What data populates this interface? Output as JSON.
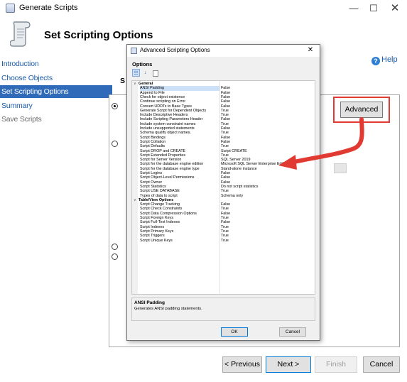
{
  "window": {
    "title": "Generate Scripts",
    "page_title": "Set Scripting Options",
    "controls": [
      "—",
      "☐",
      "✕"
    ]
  },
  "sidebar": {
    "items": [
      {
        "label": "Introduction"
      },
      {
        "label": "Choose Objects"
      },
      {
        "label": "Set Scripting Options",
        "active": true
      },
      {
        "label": "Summary"
      },
      {
        "label": "Save Scripts"
      }
    ]
  },
  "help": {
    "label": "Help"
  },
  "main": {
    "partial_label": "S",
    "advanced_label": "Advanced"
  },
  "footer": {
    "previous": "< Previous",
    "next": "Next >",
    "finish": "Finish",
    "cancel": "Cancel"
  },
  "dialog": {
    "title": "Advanced Scripting Options",
    "close": "✕",
    "options_heading": "Options",
    "categories": [
      {
        "name": "General",
        "rows": [
          {
            "name": "ANSI Padding",
            "value": "False"
          },
          {
            "name": "Append to File",
            "value": "False"
          },
          {
            "name": "Check for object existence",
            "value": "False"
          },
          {
            "name": "Continue scripting on Error",
            "value": "False"
          },
          {
            "name": "Convert UDDTs to Base Types",
            "value": "False"
          },
          {
            "name": "Generate Script for Dependent Objects",
            "value": "True"
          },
          {
            "name": "Include Descriptive Headers",
            "value": "True"
          },
          {
            "name": "Include Scripting Parameters Header",
            "value": "False"
          },
          {
            "name": "Include system constraint names",
            "value": "True"
          },
          {
            "name": "Include unsupported statements",
            "value": "False"
          },
          {
            "name": "Schema qualify object names.",
            "value": "True"
          },
          {
            "name": "Script Bindings",
            "value": "False"
          },
          {
            "name": "Script Collation",
            "value": "False"
          },
          {
            "name": "Script Defaults",
            "value": "True"
          },
          {
            "name": "Script DROP and CREATE",
            "value": "Script CREATE"
          },
          {
            "name": "Script Extended Properties",
            "value": "True"
          },
          {
            "name": "Script for Server Version",
            "value": "SQL Server 2019"
          },
          {
            "name": "Script for the database engine edition",
            "value": "Microsoft SQL Server Enterprise Edition"
          },
          {
            "name": "Script for the database engine type",
            "value": "Stand-alone instance"
          },
          {
            "name": "Script Logins",
            "value": "False"
          },
          {
            "name": "Script Object-Level Permissions",
            "value": "False"
          },
          {
            "name": "Script Owner",
            "value": "False"
          },
          {
            "name": "Script Statistics",
            "value": "Do not script statistics"
          },
          {
            "name": "Script USE DATABASE",
            "value": "True"
          },
          {
            "name": "Types of data to script",
            "value": "Schema only"
          }
        ]
      },
      {
        "name": "Table/View Options",
        "rows": [
          {
            "name": "Script Change Tracking",
            "value": "False"
          },
          {
            "name": "Script Check Constraints",
            "value": "True"
          },
          {
            "name": "Script Data Compression Options",
            "value": "False"
          },
          {
            "name": "Script Foreign Keys",
            "value": "True"
          },
          {
            "name": "Script Full-Text Indexes",
            "value": "False"
          },
          {
            "name": "Script Indexes",
            "value": "True"
          },
          {
            "name": "Script Primary Keys",
            "value": "True"
          },
          {
            "name": "Script Triggers",
            "value": "True"
          },
          {
            "name": "Script Unique Keys",
            "value": "True"
          }
        ]
      }
    ],
    "description": {
      "title": "ANSI Padding",
      "text": "Generates ANSI padding statements."
    },
    "ok": "OK",
    "cancel": "Cancel"
  },
  "colors": {
    "accent": "#2f6bb8",
    "highlight": "#e03a32",
    "link": "#1a5aa8"
  }
}
